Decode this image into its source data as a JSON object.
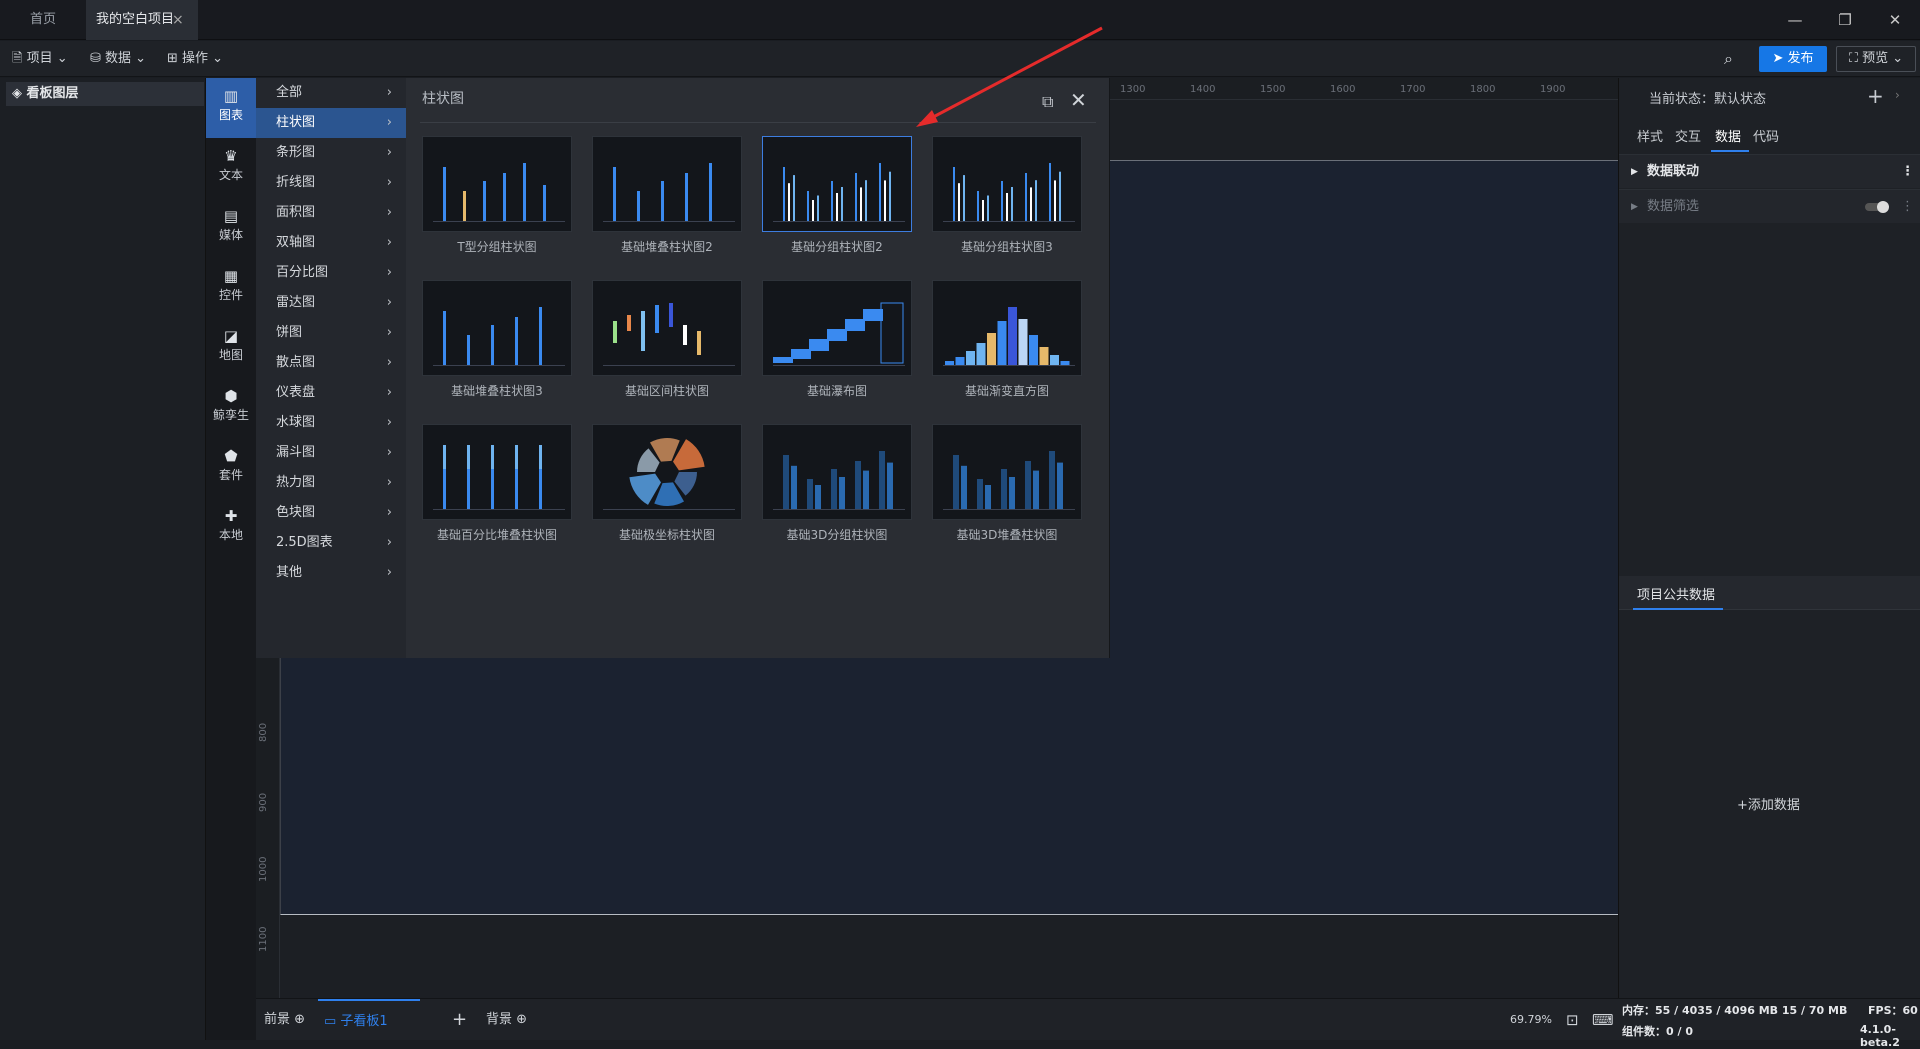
{
  "titlebar": {
    "tabs": [
      "首页",
      "我的空白项目"
    ],
    "close": "×",
    "win": [
      "—",
      "❐",
      "✕"
    ]
  },
  "toolbar": {
    "menus": [
      "项目",
      "数据",
      "操作"
    ],
    "publish": "发布",
    "preview": "预览"
  },
  "layers": {
    "title": "看板图层"
  },
  "rail": [
    {
      "label": "图表",
      "icon": "bar-chart-icon"
    },
    {
      "label": "文本",
      "icon": "crown-icon"
    },
    {
      "label": "媒体",
      "icon": "lock-icon"
    },
    {
      "label": "控件",
      "icon": "control-icon"
    },
    {
      "label": "地图",
      "icon": "map-icon"
    },
    {
      "label": "鲸孪生",
      "icon": "cube-icon"
    },
    {
      "label": "套件",
      "icon": "shirt-icon"
    },
    {
      "label": "本地",
      "icon": "puzzle-icon"
    }
  ],
  "subcategories": [
    "全部",
    "柱状图",
    "条形图",
    "折线图",
    "面积图",
    "双轴图",
    "百分比图",
    "雷达图",
    "饼图",
    "散点图",
    "仪表盘",
    "水球图",
    "漏斗图",
    "热力图",
    "色块图",
    "2.5D图表",
    "其他"
  ],
  "gallery": {
    "title": "柱状图",
    "cards": [
      "T型分组柱状图",
      "基础堆叠柱状图2",
      "基础分组柱状图2",
      "基础分组柱状图3",
      "基础堆叠柱状图3",
      "基础区间柱状图",
      "基础瀑布图",
      "基础渐变直方图",
      "基础百分比堆叠柱状图",
      "基础极坐标柱状图",
      "基础3D分组柱状图",
      "基础3D堆叠柱状图"
    ]
  },
  "ruler": {
    "top": [
      "1300",
      "1400",
      "1500",
      "1600",
      "1700",
      "1800",
      "1900"
    ],
    "left": [
      "800",
      "900",
      "1000",
      "1100"
    ]
  },
  "right": {
    "state_label": "当前状态：默认状态",
    "tabs": [
      "样式",
      "交互",
      "数据",
      "代码"
    ],
    "rows": [
      "数据联动",
      "数据筛选"
    ],
    "public_data": "项目公共数据",
    "add_data": "添加数据"
  },
  "footer": {
    "fg": "前景",
    "board": "子看板1",
    "bg": "背景",
    "zoom": "69.79%",
    "mem": "内存：55 / 4035 / 4096 MB  15 / 70 MB",
    "fps": "FPS：60",
    "comp": "组件数：0 / 0",
    "version": "4.1.0-beta.2"
  }
}
